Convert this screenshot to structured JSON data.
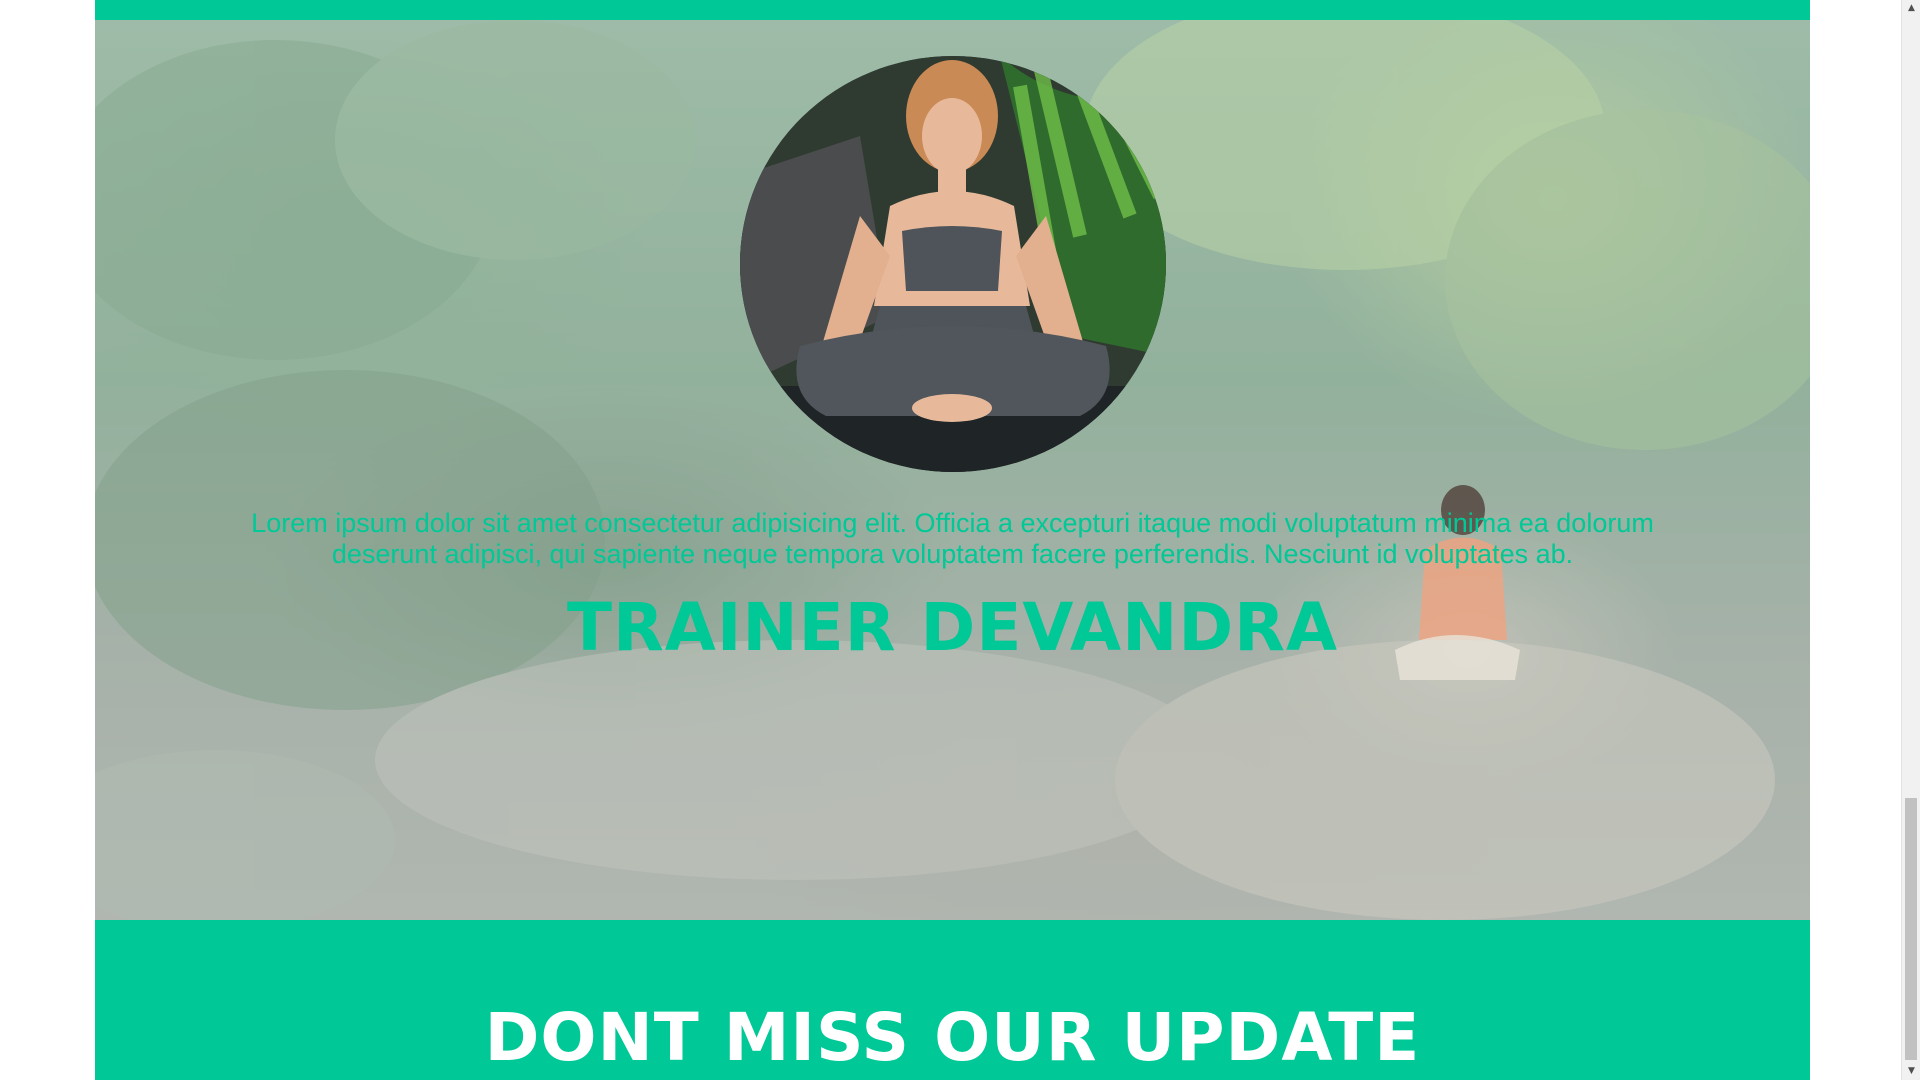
{
  "trainer_section": {
    "bio": "Lorem ipsum dolor sit amet consectetur adipisicing elit. Officia a excepturi itaque modi voluptatum minima ea dolorum deserunt adipisci, qui sapiente neque tempora voluptatem facere perferendis. Nesciunt id voluptates ab.",
    "name": "TRAINER DEVANDRA"
  },
  "update_section": {
    "title": "DONT MISS OUR UPDATE"
  },
  "colors": {
    "accent": "#00c896",
    "heading_on_accent": "#ffffff"
  },
  "icons": {
    "scroll_up": "scroll-up-arrow-icon",
    "scroll_down": "scroll-down-arrow-icon"
  }
}
